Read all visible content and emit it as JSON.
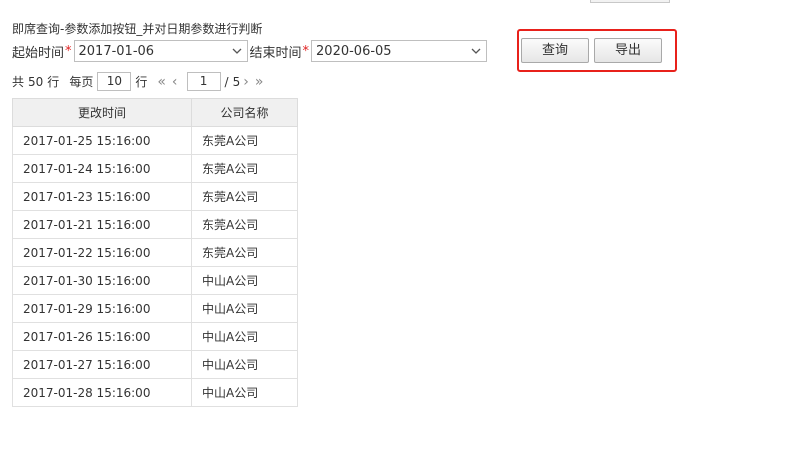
{
  "page": {
    "title": "即席查询-参数添加按钮_并对日期参数进行判断"
  },
  "params": {
    "start_label": "起始时间",
    "start_value": "2017-01-06",
    "end_label": "结束时间",
    "end_value": "2020-06-05",
    "required_mark": "*"
  },
  "buttons": {
    "query": "查询",
    "export": "导出"
  },
  "pager": {
    "total_prefix": "共",
    "total_count": "50",
    "total_suffix": "行",
    "per_page_label": "每页",
    "per_page_value": "10",
    "per_page_suffix": "行",
    "first": "«",
    "prev": "‹",
    "current_page": "1",
    "page_sep": "/",
    "total_pages": "5",
    "next": "›",
    "last": "»"
  },
  "table": {
    "headers": [
      "更改时间",
      "公司名称"
    ],
    "rows": [
      [
        "2017-01-25  15:16:00",
        "东莞A公司"
      ],
      [
        "2017-01-24  15:16:00",
        "东莞A公司"
      ],
      [
        "2017-01-23  15:16:00",
        "东莞A公司"
      ],
      [
        "2017-01-21  15:16:00",
        "东莞A公司"
      ],
      [
        "2017-01-22  15:16:00",
        "东莞A公司"
      ],
      [
        "2017-01-30  15:16:00",
        "中山A公司"
      ],
      [
        "2017-01-29  15:16:00",
        "中山A公司"
      ],
      [
        "2017-01-26  15:16:00",
        "中山A公司"
      ],
      [
        "2017-01-27  15:16:00",
        "中山A公司"
      ],
      [
        "2017-01-28  15:16:00",
        "中山A公司"
      ]
    ]
  },
  "colors": {
    "highlight": "#e8211b",
    "required": "#e02020",
    "header_bg": "#f0f0f0"
  }
}
